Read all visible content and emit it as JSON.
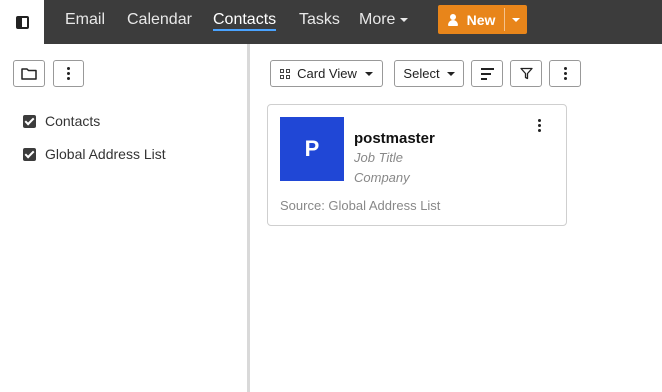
{
  "topnav": {
    "items": [
      {
        "label": "Email"
      },
      {
        "label": "Calendar"
      },
      {
        "label": "Contacts"
      },
      {
        "label": "Tasks"
      },
      {
        "label": "More"
      }
    ],
    "active": "Contacts",
    "new_button": {
      "label": "New"
    }
  },
  "sidebar": {
    "lists": [
      {
        "label": "Contacts",
        "checked": true
      },
      {
        "label": "Global Address List",
        "checked": true
      }
    ]
  },
  "toolbar": {
    "view_label": "Card View",
    "select_label": "Select"
  },
  "contacts": [
    {
      "initial": "P",
      "name": "postmaster",
      "job_title": "Job Title",
      "company": "Company",
      "source": "Source: Global Address List"
    }
  ],
  "colors": {
    "topbar": "#3c3c3c",
    "accent": "#e8851a",
    "avatar": "#2047d6",
    "active_underline": "#4aa3ff"
  },
  "icons": [
    "sidebar-toggle-icon",
    "folder-icon",
    "kebab-icon",
    "grid-icon",
    "sort-icon",
    "filter-icon",
    "person-icon",
    "chevron-down-icon"
  ]
}
